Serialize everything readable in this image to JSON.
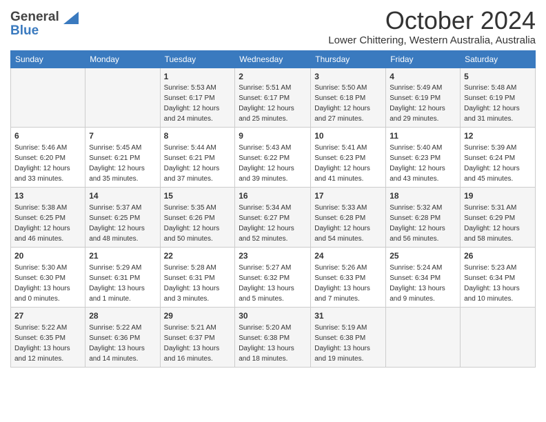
{
  "logo": {
    "general": "General",
    "blue": "Blue"
  },
  "title": "October 2024",
  "location": "Lower Chittering, Western Australia, Australia",
  "days_of_week": [
    "Sunday",
    "Monday",
    "Tuesday",
    "Wednesday",
    "Thursday",
    "Friday",
    "Saturday"
  ],
  "weeks": [
    [
      {
        "day": null,
        "info": null
      },
      {
        "day": null,
        "info": null
      },
      {
        "day": "1",
        "sunrise": "5:53 AM",
        "sunset": "6:17 PM",
        "daylight": "12 hours and 24 minutes."
      },
      {
        "day": "2",
        "sunrise": "5:51 AM",
        "sunset": "6:17 PM",
        "daylight": "12 hours and 25 minutes."
      },
      {
        "day": "3",
        "sunrise": "5:50 AM",
        "sunset": "6:18 PM",
        "daylight": "12 hours and 27 minutes."
      },
      {
        "day": "4",
        "sunrise": "5:49 AM",
        "sunset": "6:19 PM",
        "daylight": "12 hours and 29 minutes."
      },
      {
        "day": "5",
        "sunrise": "5:48 AM",
        "sunset": "6:19 PM",
        "daylight": "12 hours and 31 minutes."
      }
    ],
    [
      {
        "day": "6",
        "sunrise": "5:46 AM",
        "sunset": "6:20 PM",
        "daylight": "12 hours and 33 minutes."
      },
      {
        "day": "7",
        "sunrise": "5:45 AM",
        "sunset": "6:21 PM",
        "daylight": "12 hours and 35 minutes."
      },
      {
        "day": "8",
        "sunrise": "5:44 AM",
        "sunset": "6:21 PM",
        "daylight": "12 hours and 37 minutes."
      },
      {
        "day": "9",
        "sunrise": "5:43 AM",
        "sunset": "6:22 PM",
        "daylight": "12 hours and 39 minutes."
      },
      {
        "day": "10",
        "sunrise": "5:41 AM",
        "sunset": "6:23 PM",
        "daylight": "12 hours and 41 minutes."
      },
      {
        "day": "11",
        "sunrise": "5:40 AM",
        "sunset": "6:23 PM",
        "daylight": "12 hours and 43 minutes."
      },
      {
        "day": "12",
        "sunrise": "5:39 AM",
        "sunset": "6:24 PM",
        "daylight": "12 hours and 45 minutes."
      }
    ],
    [
      {
        "day": "13",
        "sunrise": "5:38 AM",
        "sunset": "6:25 PM",
        "daylight": "12 hours and 46 minutes."
      },
      {
        "day": "14",
        "sunrise": "5:37 AM",
        "sunset": "6:25 PM",
        "daylight": "12 hours and 48 minutes."
      },
      {
        "day": "15",
        "sunrise": "5:35 AM",
        "sunset": "6:26 PM",
        "daylight": "12 hours and 50 minutes."
      },
      {
        "day": "16",
        "sunrise": "5:34 AM",
        "sunset": "6:27 PM",
        "daylight": "12 hours and 52 minutes."
      },
      {
        "day": "17",
        "sunrise": "5:33 AM",
        "sunset": "6:28 PM",
        "daylight": "12 hours and 54 minutes."
      },
      {
        "day": "18",
        "sunrise": "5:32 AM",
        "sunset": "6:28 PM",
        "daylight": "12 hours and 56 minutes."
      },
      {
        "day": "19",
        "sunrise": "5:31 AM",
        "sunset": "6:29 PM",
        "daylight": "12 hours and 58 minutes."
      }
    ],
    [
      {
        "day": "20",
        "sunrise": "5:30 AM",
        "sunset": "6:30 PM",
        "daylight": "13 hours and 0 minutes."
      },
      {
        "day": "21",
        "sunrise": "5:29 AM",
        "sunset": "6:31 PM",
        "daylight": "13 hours and 1 minute."
      },
      {
        "day": "22",
        "sunrise": "5:28 AM",
        "sunset": "6:31 PM",
        "daylight": "13 hours and 3 minutes."
      },
      {
        "day": "23",
        "sunrise": "5:27 AM",
        "sunset": "6:32 PM",
        "daylight": "13 hours and 5 minutes."
      },
      {
        "day": "24",
        "sunrise": "5:26 AM",
        "sunset": "6:33 PM",
        "daylight": "13 hours and 7 minutes."
      },
      {
        "day": "25",
        "sunrise": "5:24 AM",
        "sunset": "6:34 PM",
        "daylight": "13 hours and 9 minutes."
      },
      {
        "day": "26",
        "sunrise": "5:23 AM",
        "sunset": "6:34 PM",
        "daylight": "13 hours and 10 minutes."
      }
    ],
    [
      {
        "day": "27",
        "sunrise": "5:22 AM",
        "sunset": "6:35 PM",
        "daylight": "13 hours and 12 minutes."
      },
      {
        "day": "28",
        "sunrise": "5:22 AM",
        "sunset": "6:36 PM",
        "daylight": "13 hours and 14 minutes."
      },
      {
        "day": "29",
        "sunrise": "5:21 AM",
        "sunset": "6:37 PM",
        "daylight": "13 hours and 16 minutes."
      },
      {
        "day": "30",
        "sunrise": "5:20 AM",
        "sunset": "6:38 PM",
        "daylight": "13 hours and 18 minutes."
      },
      {
        "day": "31",
        "sunrise": "5:19 AM",
        "sunset": "6:38 PM",
        "daylight": "13 hours and 19 minutes."
      },
      {
        "day": null,
        "info": null
      },
      {
        "day": null,
        "info": null
      }
    ]
  ],
  "labels": {
    "sunrise": "Sunrise:",
    "sunset": "Sunset:",
    "daylight": "Daylight:"
  }
}
